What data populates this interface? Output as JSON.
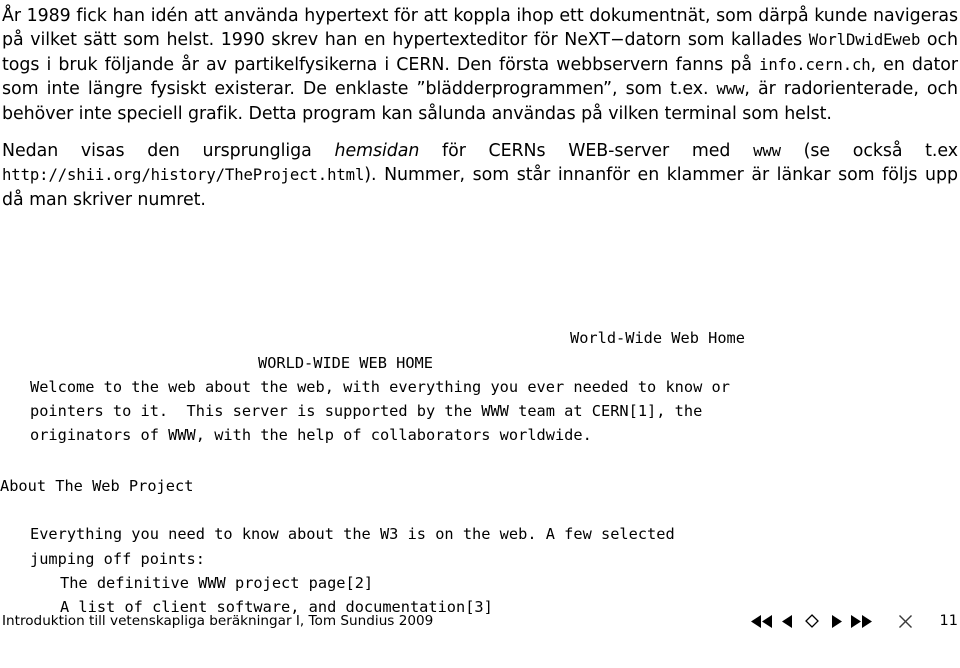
{
  "slide": {
    "paragraphs": [
      {
        "id": "p1",
        "segments": [
          {
            "type": "text",
            "text": "År 1989 fick han idén att använda hypertext för att koppla ihop ett dokumentnät, som därpå kunde navigeras på vilket sätt som helst. 1990 skrev han en hypertexteditor för NeXT−datorn som kallades "
          },
          {
            "type": "mono",
            "text": "WorlDwidEweb"
          },
          {
            "type": "text",
            "text": " och togs i bruk följande år av partikelfysikerna i CERN. Den första webbservern fanns på "
          },
          {
            "type": "mono",
            "text": "info.cern.ch"
          },
          {
            "type": "text",
            "text": ", en dator som inte längre fysiskt existerar. De enklaste ”blädderprogrammen”, som t.ex. "
          },
          {
            "type": "mono",
            "text": "www"
          },
          {
            "type": "text",
            "text": ", är radorienterade, och behöver inte speciell grafik. Detta program kan sålunda användas på vilken terminal som helst."
          }
        ]
      },
      {
        "id": "p2",
        "segments": [
          {
            "type": "text",
            "text": "Nedan visas den ursprungliga "
          },
          {
            "type": "italic",
            "text": "hemsidan"
          },
          {
            "type": "text",
            "text": " för CERNs WEB-server med "
          },
          {
            "type": "mono",
            "text": "www"
          },
          {
            "type": "text",
            "text": " (se också t.ex "
          },
          {
            "type": "mono",
            "text": "http://shii.org/history/TheProject.html"
          },
          {
            "type": "text",
            "text": "). Nummer, som står innanför en klammer är länkar som följs upp då man skriver numret."
          }
        ]
      }
    ],
    "verbatim": {
      "header_right": "World-Wide Web Home",
      "heading": "WORLD-WIDE WEB HOME",
      "body_lines": [
        "Welcome to the web about the web, with everything you ever needed to know or",
        "pointers to it.  This server is supported by the WWW team at CERN[1], the",
        "originators of WWW, with the help of collaborators worldwide."
      ],
      "section_title": "About The Web Project",
      "section_lines": [
        "Everything you need to know about the W3 is on the web. A few selected",
        "jumping off points:"
      ],
      "links": [
        "The definitive WWW project page[2]",
        "A list of client software, and documentation[3]"
      ]
    }
  },
  "footer": {
    "credit": "Introduktion till vetenskapliga beräkningar I, Tom Sundius 2009",
    "page_number": "11",
    "nav": {
      "first_label": "◀◀",
      "prev_label": "◀",
      "home_label": "◇",
      "next_label": "▶",
      "last_label": "▶▶",
      "close_label": "✕"
    }
  }
}
